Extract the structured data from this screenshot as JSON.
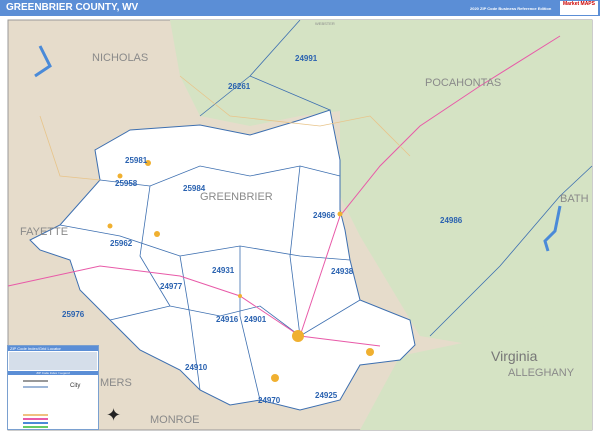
{
  "header": {
    "title": "GREENBRIER COUNTY, WV",
    "edition": "2020 ZIP Code Business Reference Edition",
    "logo_text": "Market MAPS"
  },
  "regions": {
    "nicholas": "NICHOLAS",
    "webster": "WEBSTER",
    "pocahontas": "POCAHONTAS",
    "fayette": "FAYETTE",
    "bath": "BATH",
    "greenbrier": "GREENBRIER",
    "virginia": "Virginia",
    "alleghany": "ALLEGHANY",
    "monroe": "MONROE",
    "summers": "MERS"
  },
  "zips": [
    "26261",
    "24991",
    "25981",
    "25958",
    "25984",
    "24966",
    "24986",
    "25962",
    "24931",
    "24938",
    "24977",
    "24916",
    "24901",
    "25976",
    "24910",
    "24970",
    "24925"
  ],
  "legend": {
    "title": "ZIP Code Index/Grid Locator",
    "subtitle": "ZIP Code Index / Legend",
    "compass": "✦"
  },
  "colors": {
    "header": "#5b8ed6",
    "county": "#ffffff",
    "surrounding": "#e6dccb",
    "forest": "#d5e3c4",
    "zip_boundary": "#3d6fb0",
    "highway": "#e85aa8"
  }
}
